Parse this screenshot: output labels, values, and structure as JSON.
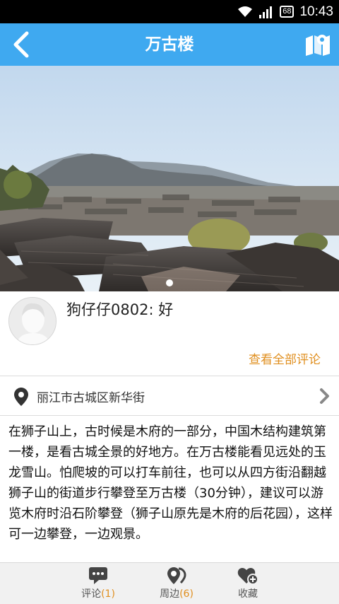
{
  "status_bar": {
    "time": "10:43",
    "battery": "68"
  },
  "header": {
    "title": "万古楼",
    "back_icon": "back-arrow-icon",
    "map_icon": "map-icon"
  },
  "gallery": {
    "pages": 1,
    "current": 1
  },
  "comment": {
    "user": "狗仔仔0802",
    "text": "狗仔仔0802: 好",
    "view_all_label": "查看全部评论"
  },
  "address": {
    "text": "丽江市古城区新华街"
  },
  "description": "在狮子山上，古时候是木府的一部分，中国木结构建筑第一楼，是看古城全景的好地方。在万古楼能看见远处的玉龙雪山。怕爬坡的可以打车前往，也可以从四方街沿翻越狮子山的街道步行攀登至万古楼（30分钟），建议可以游览木府时沿石阶攀登（狮子山原先是木府的后花园），这样可一边攀登，一边观景。",
  "bottom_nav": {
    "comments": {
      "label": "评论",
      "count": "(1)"
    },
    "nearby": {
      "label": "周边",
      "count": "(6)"
    },
    "favorite": {
      "label": "收藏"
    }
  },
  "colors": {
    "header": "#3fa9f0",
    "accent": "#e08f1f"
  }
}
